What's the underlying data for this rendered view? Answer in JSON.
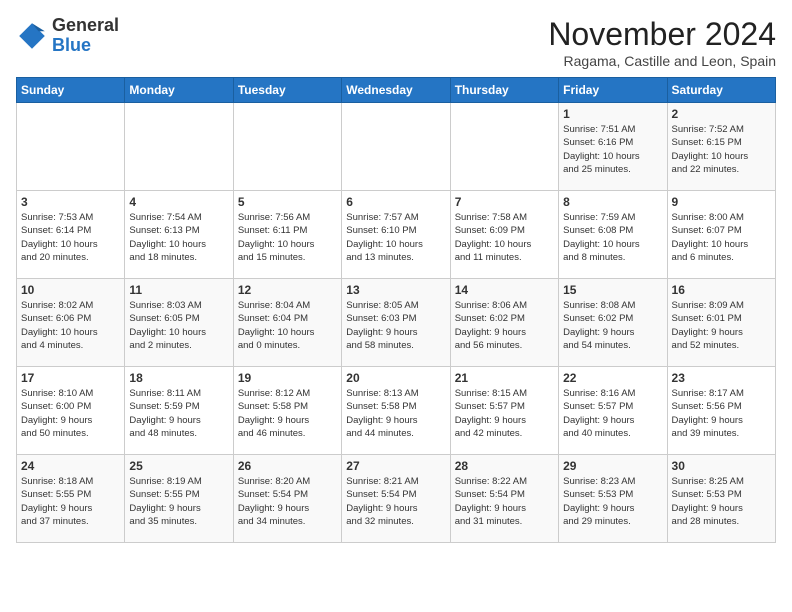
{
  "logo": {
    "general": "General",
    "blue": "Blue"
  },
  "title": "November 2024",
  "subtitle": "Ragama, Castille and Leon, Spain",
  "headers": [
    "Sunday",
    "Monday",
    "Tuesday",
    "Wednesday",
    "Thursday",
    "Friday",
    "Saturday"
  ],
  "weeks": [
    [
      {
        "day": "",
        "info": ""
      },
      {
        "day": "",
        "info": ""
      },
      {
        "day": "",
        "info": ""
      },
      {
        "day": "",
        "info": ""
      },
      {
        "day": "",
        "info": ""
      },
      {
        "day": "1",
        "info": "Sunrise: 7:51 AM\nSunset: 6:16 PM\nDaylight: 10 hours\nand 25 minutes."
      },
      {
        "day": "2",
        "info": "Sunrise: 7:52 AM\nSunset: 6:15 PM\nDaylight: 10 hours\nand 22 minutes."
      }
    ],
    [
      {
        "day": "3",
        "info": "Sunrise: 7:53 AM\nSunset: 6:14 PM\nDaylight: 10 hours\nand 20 minutes."
      },
      {
        "day": "4",
        "info": "Sunrise: 7:54 AM\nSunset: 6:13 PM\nDaylight: 10 hours\nand 18 minutes."
      },
      {
        "day": "5",
        "info": "Sunrise: 7:56 AM\nSunset: 6:11 PM\nDaylight: 10 hours\nand 15 minutes."
      },
      {
        "day": "6",
        "info": "Sunrise: 7:57 AM\nSunset: 6:10 PM\nDaylight: 10 hours\nand 13 minutes."
      },
      {
        "day": "7",
        "info": "Sunrise: 7:58 AM\nSunset: 6:09 PM\nDaylight: 10 hours\nand 11 minutes."
      },
      {
        "day": "8",
        "info": "Sunrise: 7:59 AM\nSunset: 6:08 PM\nDaylight: 10 hours\nand 8 minutes."
      },
      {
        "day": "9",
        "info": "Sunrise: 8:00 AM\nSunset: 6:07 PM\nDaylight: 10 hours\nand 6 minutes."
      }
    ],
    [
      {
        "day": "10",
        "info": "Sunrise: 8:02 AM\nSunset: 6:06 PM\nDaylight: 10 hours\nand 4 minutes."
      },
      {
        "day": "11",
        "info": "Sunrise: 8:03 AM\nSunset: 6:05 PM\nDaylight: 10 hours\nand 2 minutes."
      },
      {
        "day": "12",
        "info": "Sunrise: 8:04 AM\nSunset: 6:04 PM\nDaylight: 10 hours\nand 0 minutes."
      },
      {
        "day": "13",
        "info": "Sunrise: 8:05 AM\nSunset: 6:03 PM\nDaylight: 9 hours\nand 58 minutes."
      },
      {
        "day": "14",
        "info": "Sunrise: 8:06 AM\nSunset: 6:02 PM\nDaylight: 9 hours\nand 56 minutes."
      },
      {
        "day": "15",
        "info": "Sunrise: 8:08 AM\nSunset: 6:02 PM\nDaylight: 9 hours\nand 54 minutes."
      },
      {
        "day": "16",
        "info": "Sunrise: 8:09 AM\nSunset: 6:01 PM\nDaylight: 9 hours\nand 52 minutes."
      }
    ],
    [
      {
        "day": "17",
        "info": "Sunrise: 8:10 AM\nSunset: 6:00 PM\nDaylight: 9 hours\nand 50 minutes."
      },
      {
        "day": "18",
        "info": "Sunrise: 8:11 AM\nSunset: 5:59 PM\nDaylight: 9 hours\nand 48 minutes."
      },
      {
        "day": "19",
        "info": "Sunrise: 8:12 AM\nSunset: 5:58 PM\nDaylight: 9 hours\nand 46 minutes."
      },
      {
        "day": "20",
        "info": "Sunrise: 8:13 AM\nSunset: 5:58 PM\nDaylight: 9 hours\nand 44 minutes."
      },
      {
        "day": "21",
        "info": "Sunrise: 8:15 AM\nSunset: 5:57 PM\nDaylight: 9 hours\nand 42 minutes."
      },
      {
        "day": "22",
        "info": "Sunrise: 8:16 AM\nSunset: 5:57 PM\nDaylight: 9 hours\nand 40 minutes."
      },
      {
        "day": "23",
        "info": "Sunrise: 8:17 AM\nSunset: 5:56 PM\nDaylight: 9 hours\nand 39 minutes."
      }
    ],
    [
      {
        "day": "24",
        "info": "Sunrise: 8:18 AM\nSunset: 5:55 PM\nDaylight: 9 hours\nand 37 minutes."
      },
      {
        "day": "25",
        "info": "Sunrise: 8:19 AM\nSunset: 5:55 PM\nDaylight: 9 hours\nand 35 minutes."
      },
      {
        "day": "26",
        "info": "Sunrise: 8:20 AM\nSunset: 5:54 PM\nDaylight: 9 hours\nand 34 minutes."
      },
      {
        "day": "27",
        "info": "Sunrise: 8:21 AM\nSunset: 5:54 PM\nDaylight: 9 hours\nand 32 minutes."
      },
      {
        "day": "28",
        "info": "Sunrise: 8:22 AM\nSunset: 5:54 PM\nDaylight: 9 hours\nand 31 minutes."
      },
      {
        "day": "29",
        "info": "Sunrise: 8:23 AM\nSunset: 5:53 PM\nDaylight: 9 hours\nand 29 minutes."
      },
      {
        "day": "30",
        "info": "Sunrise: 8:25 AM\nSunset: 5:53 PM\nDaylight: 9 hours\nand 28 minutes."
      }
    ]
  ]
}
